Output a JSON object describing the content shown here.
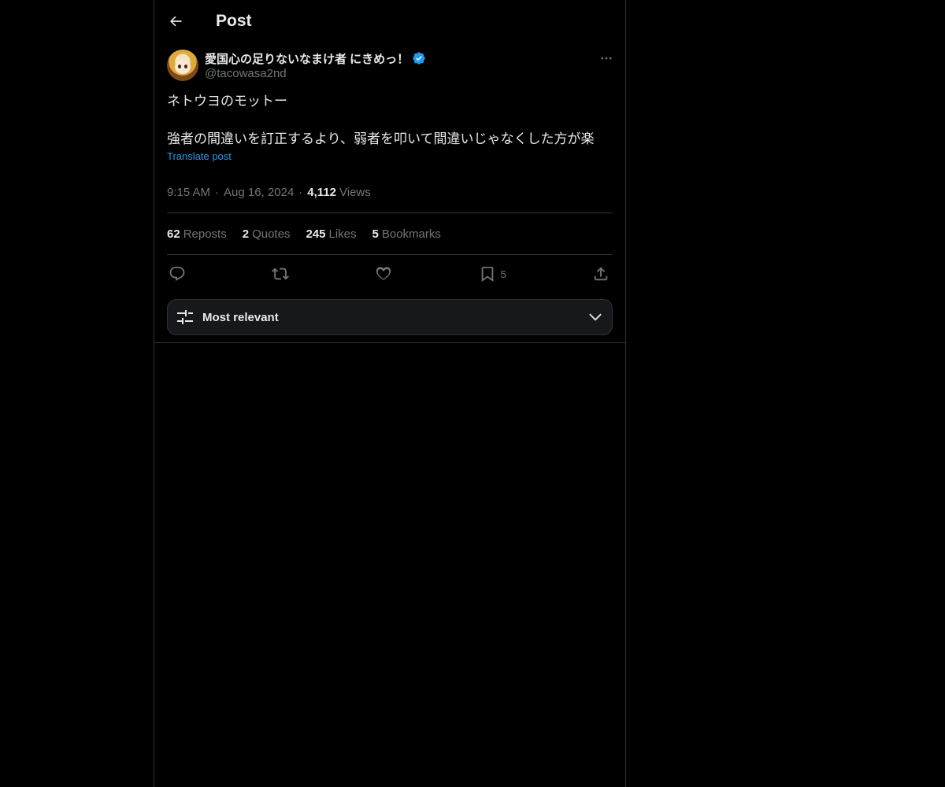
{
  "header": {
    "title": "Post"
  },
  "author": {
    "display_name": "愛国心の足りないなまけ者 にきめっ！",
    "handle": "@tacowasa2nd"
  },
  "post": {
    "text": "ネトウヨのモットー\n\n強者の間違いを訂正するより、弱者を叩いて間違いじゃなくした方が楽",
    "translate_label": "Translate post",
    "time": "9:15 AM",
    "date": "Aug 16, 2024",
    "views_count": "4,112",
    "views_label": "Views"
  },
  "stats": {
    "reposts": {
      "count": "62",
      "label": "Reposts"
    },
    "quotes": {
      "count": "2",
      "label": "Quotes"
    },
    "likes": {
      "count": "245",
      "label": "Likes"
    },
    "bookmarks": {
      "count": "5",
      "label": "Bookmarks"
    }
  },
  "actions": {
    "bookmark_count": "5"
  },
  "sort": {
    "label": "Most relevant"
  },
  "colors": {
    "background": "#000000",
    "text": "#e7e9ea",
    "muted": "#71767b",
    "accent": "#1d9bf0",
    "border": "#2f3336"
  },
  "icons": [
    "back-arrow-icon",
    "verified-badge-icon",
    "more-icon",
    "reply-icon",
    "repost-icon",
    "like-icon",
    "bookmark-icon",
    "share-icon",
    "filter-icon",
    "chevron-down-icon"
  ]
}
